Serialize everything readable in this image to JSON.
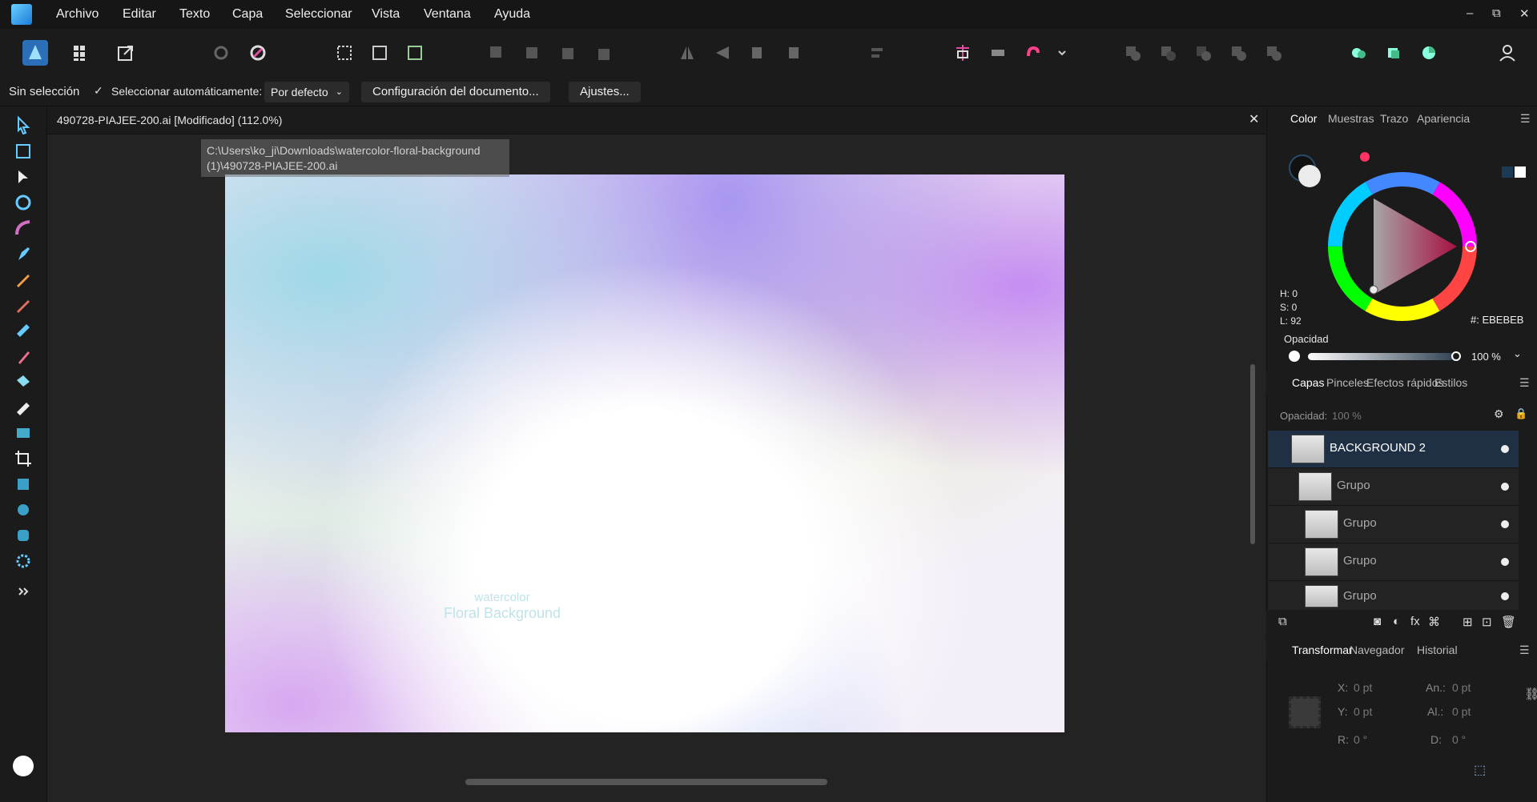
{
  "menu": {
    "items": [
      "Archivo",
      "Editar",
      "Texto",
      "Capa",
      "Seleccionar",
      "Vista",
      "Ventana",
      "Ayuda"
    ]
  },
  "window_controls": {
    "minimize": "–",
    "restore": "⧉",
    "close": "✕"
  },
  "contextbar": {
    "selection_status": "Sin selección",
    "auto_select_label": "Seleccionar automáticamente:",
    "auto_select_checked": true,
    "auto_select_value": "Por defecto",
    "doc_setup_button": "Configuración del documento...",
    "settings_button": "Ajustes..."
  },
  "document": {
    "tab_title": "490728-PIAJEE-200.ai [Modificado] (112.0%)",
    "tooltip_line1": "C:\\Users\\ko_ji\\Downloads\\watercolor-floral-background",
    "tooltip_line2": "(1)\\490728-PIAJEE-200.ai",
    "canvas_text_line1": "watercolor",
    "canvas_text_line2": "Floral Background"
  },
  "color_panel": {
    "tabs": [
      "Color",
      "Muestras",
      "Trazo",
      "Apariencia"
    ],
    "active_tab": "Color",
    "h": "H: 0",
    "s": "S: 0",
    "l": "L: 92",
    "hex": "#: EBEBEB",
    "opacity_label": "Opacidad",
    "opacity_value": "100 %",
    "accent": "#ff3366",
    "fill_color": "#ebebeb"
  },
  "layers_panel": {
    "tabs": [
      "Capas",
      "Pinceles",
      "Efectos rápidos",
      "Estilos"
    ],
    "active_tab": "Capas",
    "opacity_label": "Opacidad:",
    "opacity_value": "100 %",
    "layers": [
      {
        "name": "BACKGROUND 2",
        "selected": true
      },
      {
        "name": "Grupo",
        "selected": false
      },
      {
        "name": "Grupo",
        "selected": false
      },
      {
        "name": "Grupo",
        "selected": false
      },
      {
        "name": "Grupo",
        "selected": false
      }
    ]
  },
  "transform_panel": {
    "tabs": [
      "Transformar",
      "Navegador",
      "Historial"
    ],
    "active_tab": "Transformar",
    "x_label": "X:",
    "x_value": "0 pt",
    "y_label": "Y:",
    "y_value": "0 pt",
    "w_label": "An.:",
    "w_value": "0 pt",
    "h_label": "Al.:",
    "h_value": "0 pt",
    "r_label": "R:",
    "r_value": "0 °",
    "s_label": "D:",
    "s_value": "0 °"
  }
}
